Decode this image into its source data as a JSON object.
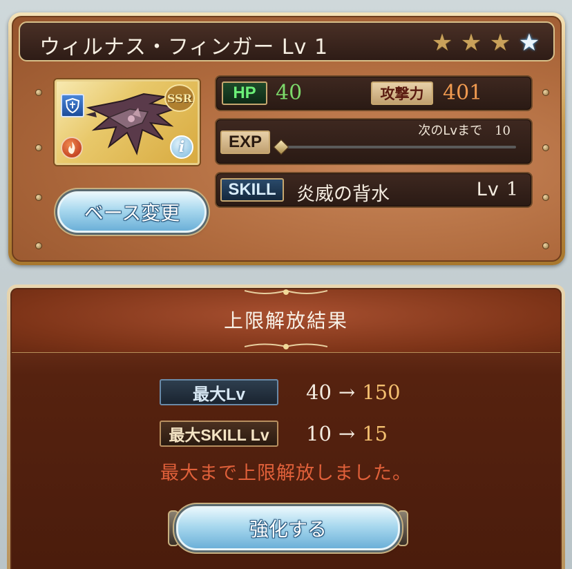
{
  "card": {
    "title": "ウィルナス・フィンガー Lv 1",
    "stars": [
      {
        "type": "gold",
        "glyph": "★"
      },
      {
        "type": "gold",
        "glyph": "★"
      },
      {
        "type": "gold",
        "glyph": "★"
      },
      {
        "type": "blue",
        "glyph": "★"
      }
    ],
    "rarity": "SSR",
    "info_glyph": "i",
    "base_change_label": "ベース変更",
    "hp_label": "HP",
    "hp_value": "40",
    "attack_label": "攻撃力",
    "attack_value": "401",
    "exp_label": "EXP",
    "next_lv_label": "次のLvまで",
    "next_lv_value": "10",
    "exp_progress": 0,
    "skill_label": "SKILL",
    "skill_name": "炎威の背水",
    "skill_lv_label": "Lv",
    "skill_lv_value": "1"
  },
  "result": {
    "title": "上限解放結果",
    "max_lv_label": "最大Lv",
    "max_lv_from": "40",
    "max_lv_to": "150",
    "max_skill_lv_label": "最大SKILL Lv",
    "max_skill_lv_from": "10",
    "max_skill_lv_to": "15",
    "arrow": "→",
    "message": "最大まで上限解放しました。",
    "strengthen_label": "強化する"
  },
  "colors": {
    "hp_value": "#7cd86a",
    "attack_value": "#f09a50",
    "result_to": "#f4c070",
    "message": "#e0603a"
  }
}
